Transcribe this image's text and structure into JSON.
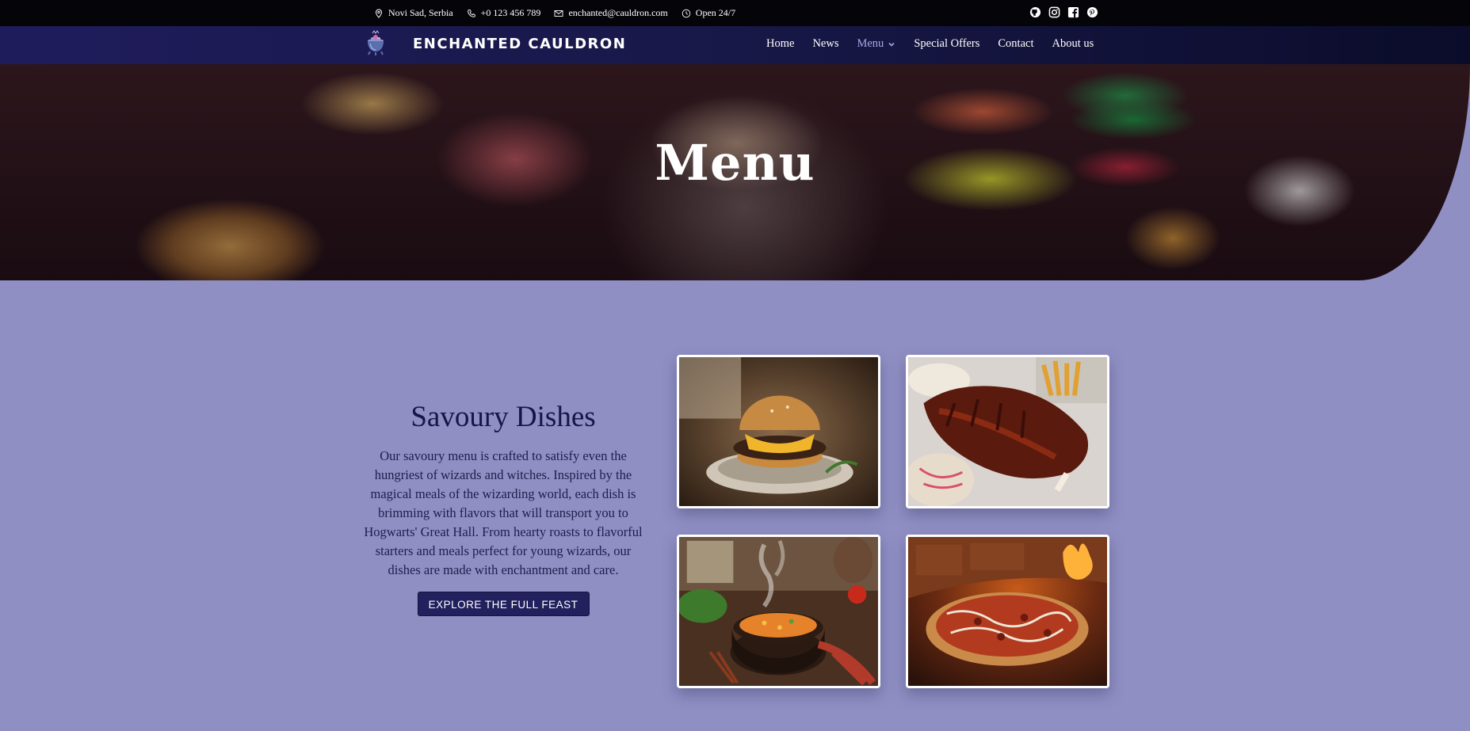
{
  "topbar": {
    "location": "Novi Sad, Serbia",
    "phone": "+0 123 456 789",
    "email": "enchanted@cauldron.com",
    "hours": "Open 24/7",
    "socials": [
      "github-icon",
      "instagram-icon",
      "facebook-icon",
      "pinterest-icon"
    ]
  },
  "navbar": {
    "brand": "ENCHANTED CAULDRON",
    "links": {
      "home": "Home",
      "news": "News",
      "menu": "Menu",
      "offers": "Special Offers",
      "contact": "Contact",
      "about": "About us"
    }
  },
  "hero": {
    "title": "Menu"
  },
  "section": {
    "title": "Savoury Dishes",
    "description": "Our savoury menu is crafted to satisfy even the hungriest of wizards and witches. Inspired by the magical meals of the wizarding world, each dish is brimming with flavors that will transport you to Hogwarts' Great Hall. From hearty roasts to flavorful starters and meals perfect for young wizards, our dishes are made with enchantment and care.",
    "button": "EXPLORE THE FULL FEAST"
  },
  "colors": {
    "background": "#8f8fc3",
    "topbar": "#050509",
    "navbar": "#1f1c5c",
    "accent": "#22205d",
    "active_link": "#a7a7e6"
  }
}
